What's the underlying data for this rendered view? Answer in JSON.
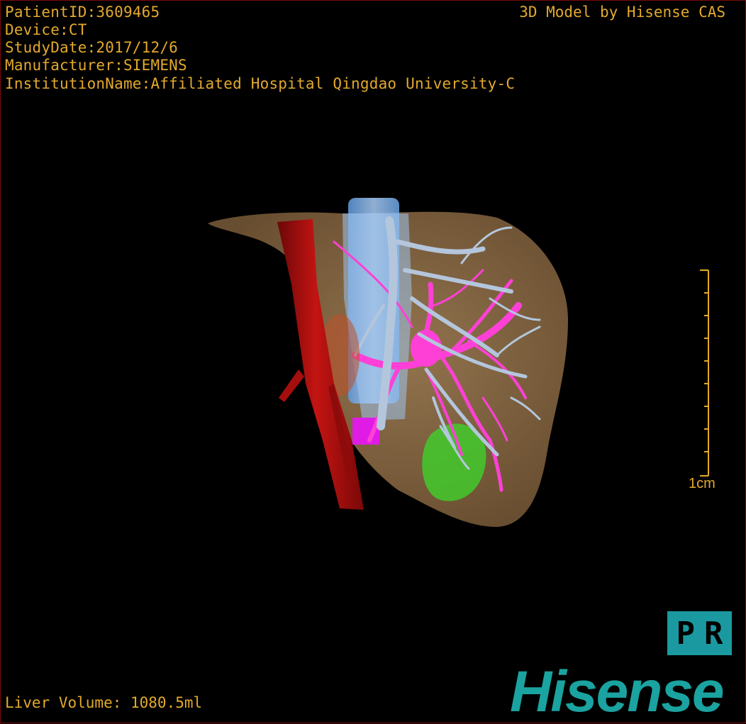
{
  "header": {
    "patient_id": "PatientID:3609465",
    "device": "Device:CT",
    "study_date": "StudyDate:2017/12/6",
    "manufacturer": "Manufacturer:SIEMENS",
    "institution": "InstitutionName:Affiliated Hospital Qingdao University-C"
  },
  "brand_top": "3D Model by Hisense CAS",
  "scale": {
    "label": "1cm"
  },
  "badge": {
    "p": "P",
    "r": "R"
  },
  "footer": {
    "volume": "Liver Volume: 1080.5ml",
    "logo": "Hisense"
  },
  "colors": {
    "text": "#e3a92c",
    "liver": "#8b6a45",
    "artery": "#b0100f",
    "vena_cava": "#7fb6ee",
    "hepatic_vein": "#b4c6dc",
    "portal_vein": "#ff40d6",
    "lesion": "#3fd12b",
    "brand": "#1aa3a0"
  }
}
